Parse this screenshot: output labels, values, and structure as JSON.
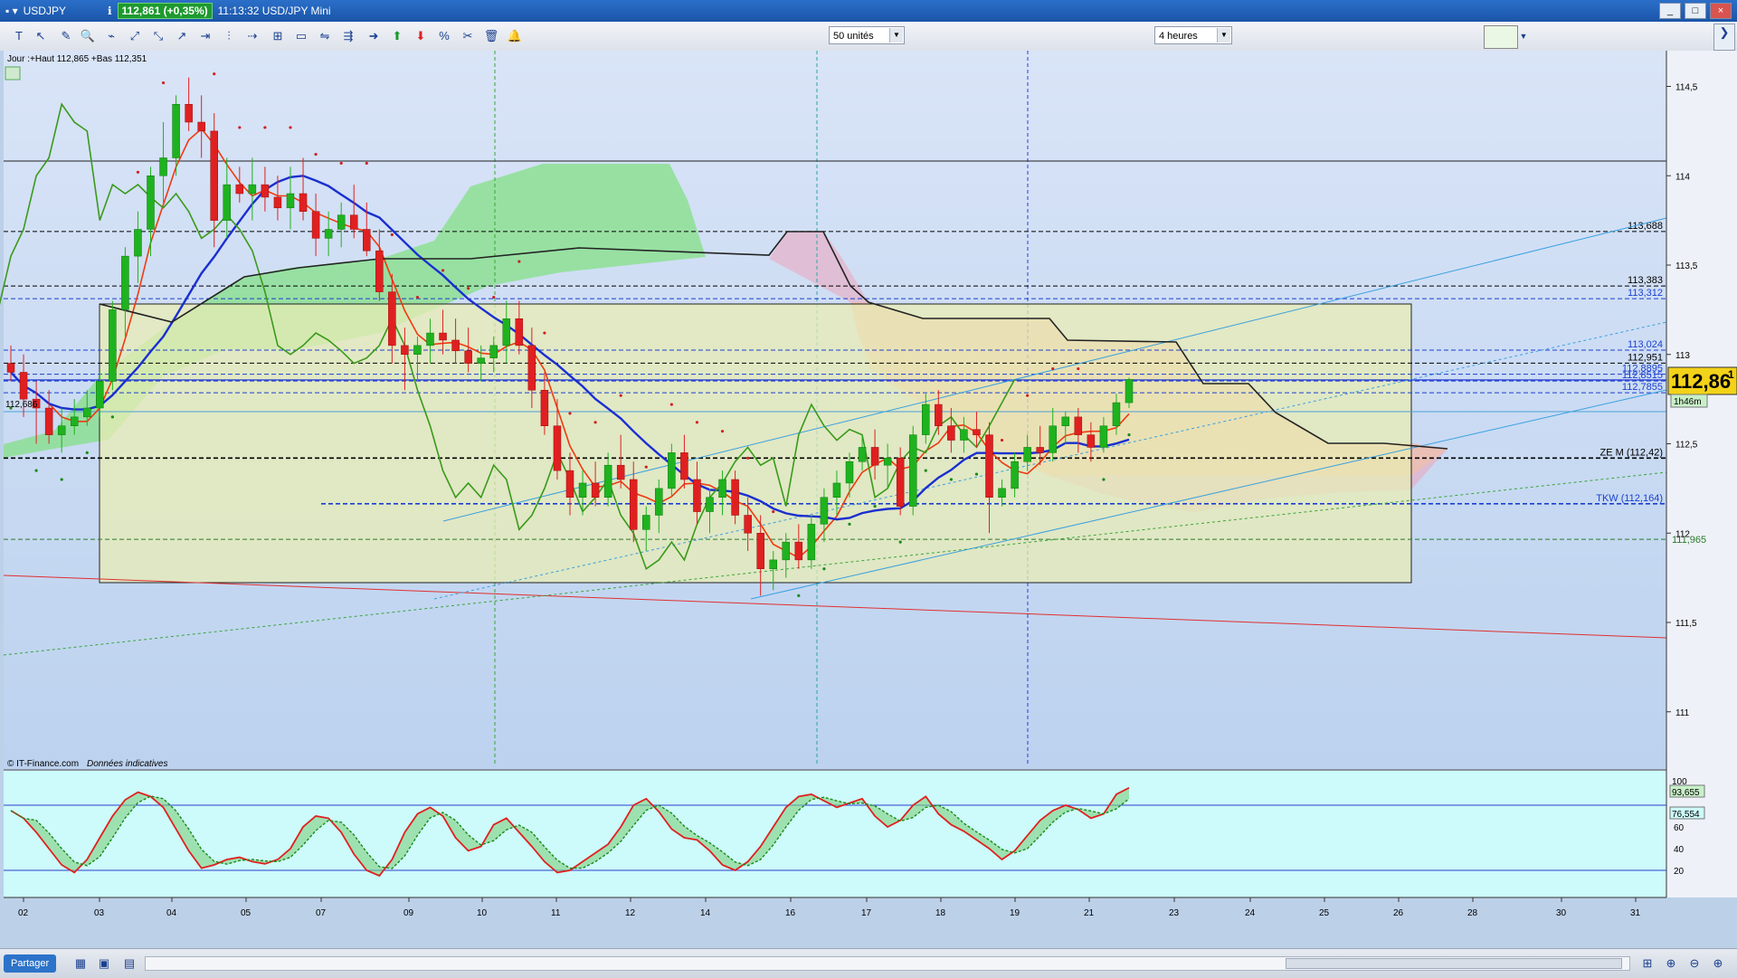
{
  "window": {
    "title": "USDJPY",
    "quote": "112,861 (+0,35%)",
    "time_title": "11:13:32 USD/JPY Mini",
    "buttons": [
      "_",
      "□",
      "×"
    ]
  },
  "toolbar": {
    "units": "50 unités",
    "period": "4 heures",
    "tools": [
      "T",
      "↖",
      "✎",
      "🔍",
      "⌁",
      "⤢",
      "⤡",
      "↗",
      "⇥",
      "⫶",
      "⇢",
      "⊞",
      "▭",
      "⇋",
      "⇶",
      "➜",
      "⬆",
      "⬇",
      "%",
      "✂",
      "🗑",
      "🔔"
    ]
  },
  "chart_data": {
    "type": "candlestick",
    "title": "",
    "info_line": "Jour :+Haut 112,865 +Bas 112,351",
    "copyright": "© IT-Finance.com",
    "copyright_note": "Données indicatives",
    "last_price_int": "112,86",
    "last_price_dec": "1",
    "countdown": "1h46m",
    "left_marker": "112,686",
    "ylim": [
      110.7,
      114.7
    ],
    "y_ticks": [
      "114,5",
      "114",
      "113,5",
      "113",
      "112,5",
      "112",
      "111,5",
      "111"
    ],
    "x_labels": [
      "02",
      "03",
      "04",
      "05",
      "07",
      "09",
      "10",
      "11",
      "12",
      "14",
      "16",
      "17",
      "18",
      "19",
      "21",
      "23",
      "24",
      "25",
      "26",
      "28",
      "30",
      "31"
    ],
    "levels": [
      {
        "label": "113,688",
        "value": 113.688,
        "color": "#000000"
      },
      {
        "label": "113,383",
        "value": 113.383,
        "color": "#000000"
      },
      {
        "label": "113,312",
        "value": 113.312,
        "color": "#1a3fd0"
      },
      {
        "label": "113,024",
        "value": 113.024,
        "color": "#1a3fd0"
      },
      {
        "label": "112,951",
        "value": 112.951,
        "color": "#000000"
      },
      {
        "label": "112,8895",
        "value": 112.8895,
        "color": "#1a3fd0"
      },
      {
        "label": "112,8515",
        "value": 112.8515,
        "color": "#1a3fd0"
      },
      {
        "label": "112,7855",
        "value": 112.7855,
        "color": "#1a3fd0"
      },
      {
        "label": "ZE M (112,42)",
        "value": 112.42,
        "color": "#000000"
      },
      {
        "label": "TKW (112,164)",
        "value": 112.164,
        "color": "#1a3fd0"
      },
      {
        "label": "111,965",
        "value": 111.965,
        "color": "#2a7a2a"
      }
    ],
    "candles": [
      [
        112.95,
        113.05,
        112.85,
        112.9
      ],
      [
        112.9,
        113.0,
        112.65,
        112.75
      ],
      [
        112.75,
        112.85,
        112.5,
        112.7
      ],
      [
        112.7,
        112.8,
        112.5,
        112.55
      ],
      [
        112.55,
        112.7,
        112.45,
        112.6
      ],
      [
        112.6,
        112.75,
        112.55,
        112.65
      ],
      [
        112.65,
        112.8,
        112.6,
        112.7
      ],
      [
        112.7,
        112.9,
        112.65,
        112.85
      ],
      [
        112.85,
        113.3,
        112.8,
        113.25
      ],
      [
        113.25,
        113.6,
        113.1,
        113.55
      ],
      [
        113.55,
        113.8,
        113.4,
        113.7
      ],
      [
        113.7,
        114.05,
        113.55,
        114.0
      ],
      [
        114.0,
        114.3,
        113.85,
        114.1
      ],
      [
        114.1,
        114.45,
        114.0,
        114.4
      ],
      [
        114.4,
        114.55,
        114.25,
        114.3
      ],
      [
        114.3,
        114.45,
        114.1,
        114.25
      ],
      [
        114.25,
        114.35,
        113.6,
        113.75
      ],
      [
        113.75,
        114.1,
        113.65,
        113.95
      ],
      [
        113.95,
        114.05,
        113.85,
        113.9
      ],
      [
        113.9,
        114.1,
        113.75,
        113.95
      ],
      [
        113.95,
        114.05,
        113.8,
        113.88
      ],
      [
        113.88,
        114.0,
        113.75,
        113.82
      ],
      [
        113.82,
        114.05,
        113.7,
        113.9
      ],
      [
        113.9,
        114.1,
        113.75,
        113.8
      ],
      [
        113.8,
        113.9,
        113.55,
        113.65
      ],
      [
        113.65,
        113.8,
        113.55,
        113.7
      ],
      [
        113.7,
        113.85,
        113.6,
        113.78
      ],
      [
        113.78,
        113.95,
        113.65,
        113.7
      ],
      [
        113.7,
        113.85,
        113.55,
        113.58
      ],
      [
        113.58,
        113.7,
        113.3,
        113.35
      ],
      [
        113.35,
        113.45,
        112.95,
        113.05
      ],
      [
        113.05,
        113.15,
        112.8,
        113.0
      ],
      [
        113.0,
        113.1,
        112.85,
        113.05
      ],
      [
        113.05,
        113.2,
        112.95,
        113.12
      ],
      [
        113.12,
        113.25,
        113.0,
        113.08
      ],
      [
        113.08,
        113.2,
        112.95,
        113.02
      ],
      [
        113.02,
        113.15,
        112.9,
        112.95
      ],
      [
        112.95,
        113.05,
        112.85,
        112.98
      ],
      [
        112.98,
        113.1,
        112.9,
        113.05
      ],
      [
        113.05,
        113.3,
        112.95,
        113.2
      ],
      [
        113.2,
        113.3,
        113.0,
        113.05
      ],
      [
        113.05,
        113.15,
        112.7,
        112.8
      ],
      [
        112.8,
        112.9,
        112.55,
        112.6
      ],
      [
        112.6,
        112.75,
        112.3,
        112.35
      ],
      [
        112.35,
        112.45,
        112.1,
        112.2
      ],
      [
        112.2,
        112.35,
        112.1,
        112.28
      ],
      [
        112.28,
        112.4,
        112.15,
        112.2
      ],
      [
        112.2,
        112.45,
        112.15,
        112.38
      ],
      [
        112.38,
        112.55,
        112.25,
        112.3
      ],
      [
        112.3,
        112.4,
        111.95,
        112.02
      ],
      [
        112.02,
        112.15,
        111.9,
        112.1
      ],
      [
        112.1,
        112.3,
        112.0,
        112.25
      ],
      [
        112.25,
        112.5,
        112.2,
        112.45
      ],
      [
        112.45,
        112.55,
        112.25,
        112.3
      ],
      [
        112.3,
        112.4,
        112.05,
        112.12
      ],
      [
        112.12,
        112.25,
        112.0,
        112.2
      ],
      [
        112.2,
        112.35,
        112.1,
        112.3
      ],
      [
        112.3,
        112.35,
        112.05,
        112.1
      ],
      [
        112.1,
        112.2,
        111.9,
        112.0
      ],
      [
        112.0,
        112.1,
        111.65,
        111.8
      ],
      [
        111.8,
        111.9,
        111.68,
        111.85
      ],
      [
        111.85,
        112.0,
        111.75,
        111.95
      ],
      [
        111.95,
        112.05,
        111.8,
        111.85
      ],
      [
        111.85,
        112.1,
        111.8,
        112.05
      ],
      [
        112.05,
        112.25,
        111.95,
        112.2
      ],
      [
        112.2,
        112.35,
        112.1,
        112.28
      ],
      [
        112.28,
        112.45,
        112.2,
        112.4
      ],
      [
        112.4,
        112.55,
        112.35,
        112.48
      ],
      [
        112.48,
        112.58,
        112.3,
        112.38
      ],
      [
        112.38,
        112.5,
        112.25,
        112.42
      ],
      [
        112.42,
        112.48,
        112.1,
        112.15
      ],
      [
        112.15,
        112.6,
        112.1,
        112.55
      ],
      [
        112.55,
        112.78,
        112.5,
        112.72
      ],
      [
        112.72,
        112.8,
        112.55,
        112.6
      ],
      [
        112.6,
        112.7,
        112.45,
        112.52
      ],
      [
        112.52,
        112.65,
        112.45,
        112.58
      ],
      [
        112.58,
        112.68,
        112.48,
        112.55
      ],
      [
        112.55,
        112.62,
        112.0,
        112.2
      ],
      [
        112.2,
        112.3,
        112.15,
        112.25
      ],
      [
        112.25,
        112.45,
        112.2,
        112.4
      ],
      [
        112.4,
        112.55,
        112.35,
        112.48
      ],
      [
        112.48,
        112.6,
        112.38,
        112.45
      ],
      [
        112.45,
        112.7,
        112.4,
        112.6
      ],
      [
        112.6,
        112.68,
        112.5,
        112.65
      ],
      [
        112.65,
        112.7,
        112.45,
        112.55
      ],
      [
        112.55,
        112.62,
        112.4,
        112.48
      ],
      [
        112.48,
        112.65,
        112.45,
        112.6
      ],
      [
        112.6,
        112.78,
        112.55,
        112.73
      ],
      [
        112.73,
        112.87,
        112.7,
        112.86
      ]
    ],
    "oscillator": {
      "label_top": "100",
      "values": [
        "93,655",
        "76,554"
      ],
      "ticks": [
        "60",
        "40",
        "20"
      ]
    }
  },
  "statusbar": {
    "share": "Partager"
  }
}
